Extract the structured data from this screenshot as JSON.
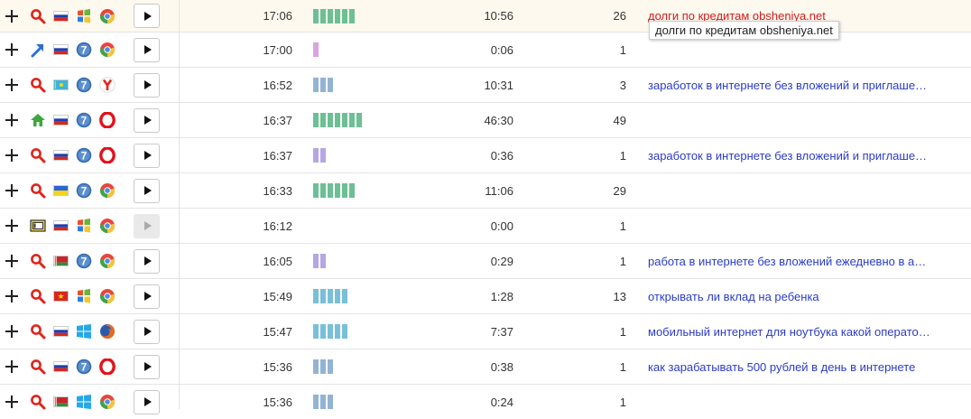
{
  "rows": [
    {
      "time": "17:06",
      "duration": "10:56",
      "views": "26",
      "query": "долги по кредитам obsheniya.net",
      "query_style": "red",
      "source_icon": "search-icon",
      "flag": "russia-flag",
      "os_icon": "windows-xp-icon",
      "browser_icon": "chrome-icon",
      "bar_count": 6,
      "bar_color": "#6dbf94",
      "play_enabled": true
    },
    {
      "time": "17:00",
      "duration": "0:06",
      "views": "1",
      "query": "",
      "query_style": "",
      "source_icon": "link-arrow-icon",
      "flag": "russia-flag",
      "os_icon": "windows-7-icon",
      "browser_icon": "chrome-icon",
      "bar_count": 1,
      "bar_color": "#d9a2e2",
      "play_enabled": true
    },
    {
      "time": "16:52",
      "duration": "10:31",
      "views": "3",
      "query": "заработок в интернете без вложений и приглаше…",
      "query_style": "",
      "source_icon": "search-icon",
      "flag": "kazakhstan-flag",
      "os_icon": "windows-7-icon",
      "browser_icon": "yandex-browser-icon",
      "bar_count": 3,
      "bar_color": "#93b3d3",
      "play_enabled": true
    },
    {
      "time": "16:37",
      "duration": "46:30",
      "views": "49",
      "query": "",
      "query_style": "",
      "source_icon": "home-icon",
      "flag": "russia-flag",
      "os_icon": "windows-7-icon",
      "browser_icon": "opera-icon",
      "bar_count": 7,
      "bar_color": "#6dbf94",
      "play_enabled": true
    },
    {
      "time": "16:37",
      "duration": "0:36",
      "views": "1",
      "query": "заработок в интернете без вложений и приглаше…",
      "query_style": "",
      "source_icon": "search-icon",
      "flag": "russia-flag",
      "os_icon": "windows-7-icon",
      "browser_icon": "opera-icon",
      "bar_count": 2,
      "bar_color": "#b7a6e3",
      "play_enabled": true
    },
    {
      "time": "16:33",
      "duration": "11:06",
      "views": "29",
      "query": "",
      "query_style": "",
      "source_icon": "search-icon",
      "flag": "ukraine-flag",
      "os_icon": "windows-7-icon",
      "browser_icon": "chrome-icon",
      "bar_count": 6,
      "bar_color": "#6dbf94",
      "play_enabled": true
    },
    {
      "time": "16:12",
      "duration": "0:00",
      "views": "1",
      "query": "",
      "query_style": "",
      "source_icon": "window-icon",
      "flag": "russia-flag",
      "os_icon": "windows-xp-icon",
      "browser_icon": "chrome-icon",
      "bar_count": 0,
      "bar_color": "#6dbf94",
      "play_enabled": false
    },
    {
      "time": "16:05",
      "duration": "0:29",
      "views": "1",
      "query": "работа в интернете без вложений ежедневно в а…",
      "query_style": "",
      "source_icon": "search-icon",
      "flag": "belarus-flag",
      "os_icon": "windows-7-icon",
      "browser_icon": "chrome-icon",
      "bar_count": 2,
      "bar_color": "#b7a6e3",
      "play_enabled": true
    },
    {
      "time": "15:49",
      "duration": "1:28",
      "views": "13",
      "query": "открывать ли вклад на ребенка",
      "query_style": "",
      "source_icon": "search-icon",
      "flag": "vietnam-flag",
      "os_icon": "windows-xp-icon",
      "browser_icon": "chrome-icon",
      "bar_count": 5,
      "bar_color": "#79bfd9",
      "play_enabled": true
    },
    {
      "time": "15:47",
      "duration": "7:37",
      "views": "1",
      "query": "мобильный интернет для ноутбука какой операто…",
      "query_style": "",
      "source_icon": "search-icon",
      "flag": "russia-flag",
      "os_icon": "windows-8-icon",
      "browser_icon": "firefox-icon",
      "bar_count": 5,
      "bar_color": "#79bfd9",
      "play_enabled": true
    },
    {
      "time": "15:36",
      "duration": "0:38",
      "views": "1",
      "query": "как зарабатывать 500 рублей в день в интернете",
      "query_style": "",
      "source_icon": "search-icon",
      "flag": "russia-flag",
      "os_icon": "windows-7-icon",
      "browser_icon": "opera-icon",
      "bar_count": 3,
      "bar_color": "#93b3d3",
      "play_enabled": true
    },
    {
      "time": "15:36",
      "duration": "0:24",
      "views": "1",
      "query": "",
      "query_style": "",
      "source_icon": "search-icon",
      "flag": "belarus-flag",
      "os_icon": "windows-8-icon",
      "browser_icon": "chrome-icon",
      "bar_count": 3,
      "bar_color": "#93b3d3",
      "play_enabled": true
    }
  ],
  "tooltip": {
    "text": "долги по кредитам obsheniya.net"
  }
}
